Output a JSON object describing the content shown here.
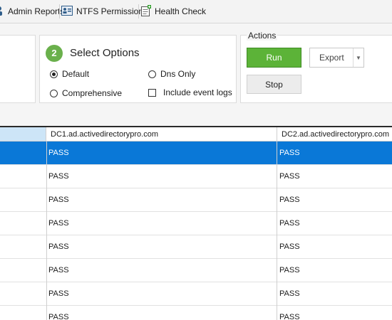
{
  "toolbar": {
    "items": [
      {
        "label": "Admin Reports",
        "icon": "admin-reports-icon"
      },
      {
        "label": "NTFS Permissions",
        "icon": "ntfs-permissions-icon"
      },
      {
        "label": "Health Check",
        "icon": "health-check-icon"
      }
    ]
  },
  "options": {
    "step_number": "2",
    "title": "Select Options",
    "radios": [
      {
        "label": "Default",
        "selected": true
      },
      {
        "label": "Dns Only",
        "selected": false
      },
      {
        "label": "Comprehensive",
        "selected": false
      }
    ],
    "include_event_logs": {
      "label": "Include event logs",
      "checked": false
    }
  },
  "actions": {
    "title": "Actions",
    "run_label": "Run",
    "export_label": "Export",
    "stop_label": "Stop"
  },
  "grid": {
    "columns": [
      "",
      "DC1.ad.activedirectorypro.com",
      "DC2.ad.activedirectorypro.com"
    ],
    "rows": [
      [
        "",
        "PASS",
        "PASS"
      ],
      [
        "",
        "PASS",
        "PASS"
      ],
      [
        "",
        "PASS",
        "PASS"
      ],
      [
        "",
        "PASS",
        "PASS"
      ],
      [
        "",
        "PASS",
        "PASS"
      ],
      [
        "",
        "PASS",
        "PASS"
      ],
      [
        "",
        "PASS",
        "PASS"
      ],
      [
        "",
        "PASS",
        "PASS"
      ]
    ],
    "selected_row": 0
  },
  "colors": {
    "accent_green": "#5cb338",
    "selection_blue": "#0a78d7",
    "step_circle": "#6ab04c"
  }
}
